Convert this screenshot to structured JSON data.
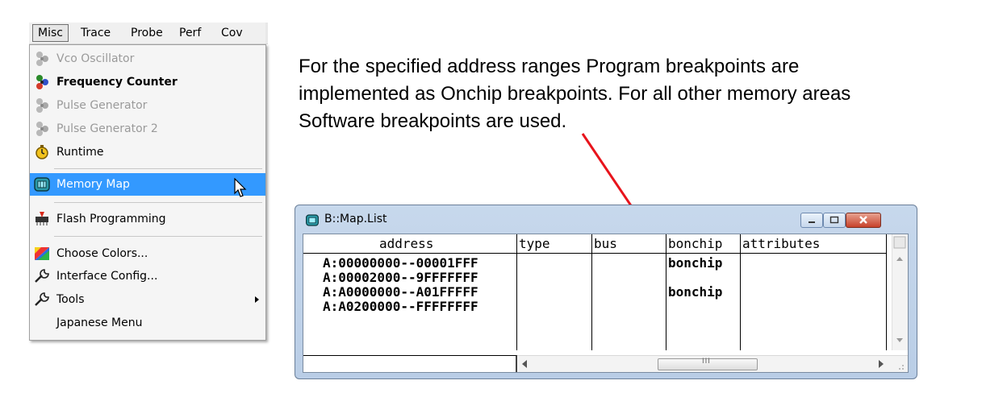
{
  "menubar": {
    "items": [
      {
        "label": "Misc",
        "active": true
      },
      {
        "label": "Trace"
      },
      {
        "label": "Probe"
      },
      {
        "label": "Perf"
      },
      {
        "label": "Cov"
      }
    ]
  },
  "dropdown": {
    "items": [
      {
        "label": "Vco Oscillator",
        "state": "disabled",
        "icon": "fan-icon"
      },
      {
        "label": "Frequency Counter",
        "state": "bold",
        "icon": "fan-icon"
      },
      {
        "label": "Pulse Generator",
        "state": "disabled",
        "icon": "fan-icon"
      },
      {
        "label": "Pulse Generator 2",
        "state": "disabled",
        "icon": "fan-icon"
      },
      {
        "label": "Runtime",
        "state": "normal",
        "icon": "stopwatch-icon"
      },
      {
        "label": "Memory Map",
        "state": "highlighted",
        "icon": "memory-map-icon"
      },
      {
        "label": "Flash Programming",
        "state": "normal",
        "icon": "flash-chip-icon"
      },
      {
        "label": "Choose Colors...",
        "state": "normal",
        "icon": "palette-icon"
      },
      {
        "label": "Interface Config...",
        "state": "normal",
        "icon": "wrench-icon"
      },
      {
        "label": "Tools",
        "state": "normal",
        "icon": "wrench-icon",
        "submenu": true
      },
      {
        "label": "Japanese Menu",
        "state": "normal"
      }
    ]
  },
  "description": {
    "lines": [
      "For the specified address ranges Program breakpoints are",
      "implemented as Onchip breakpoints. For all other memory areas",
      "Software breakpoints are used."
    ]
  },
  "window": {
    "title": "B::Map.List",
    "columns": [
      "address",
      "type",
      "bus",
      "bonchip",
      "attributes"
    ],
    "rows": [
      {
        "address": "A:00000000--00001FFF",
        "type": "",
        "bus": "",
        "bonchip": "bonchip",
        "attributes": ""
      },
      {
        "address": "A:00002000--9FFFFFFF",
        "type": "",
        "bus": "",
        "bonchip": "",
        "attributes": ""
      },
      {
        "address": "A:A0000000--A01FFFFF",
        "type": "",
        "bus": "",
        "bonchip": "bonchip",
        "attributes": ""
      },
      {
        "address": "A:A0200000--FFFFFFFF",
        "type": "",
        "bus": "",
        "bonchip": "",
        "attributes": ""
      }
    ],
    "scroll_thumb_label": "III"
  },
  "colors": {
    "highlight": "#3399ff",
    "annotation_arrow": "#e8141c",
    "window_frame": "#c7d8ec"
  }
}
